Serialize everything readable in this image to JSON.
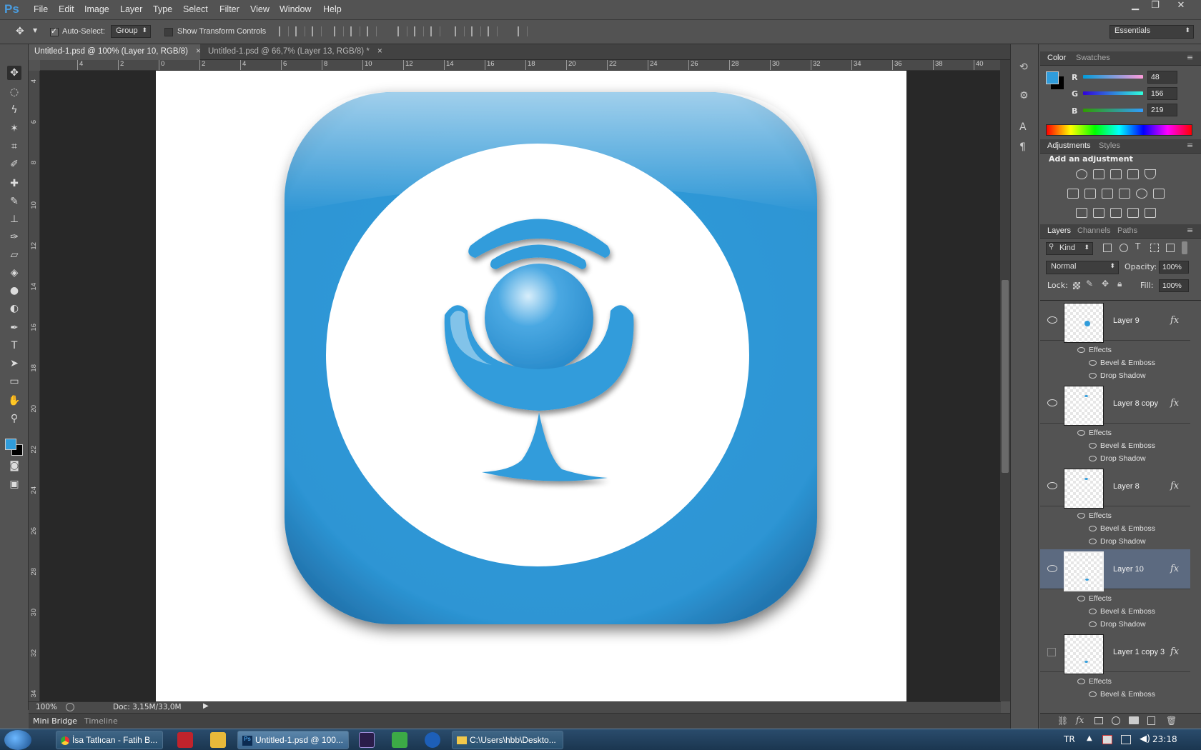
{
  "menubar": {
    "app_logo": "Ps",
    "items": [
      "File",
      "Edit",
      "Image",
      "Layer",
      "Type",
      "Select",
      "Filter",
      "View",
      "Window",
      "Help"
    ]
  },
  "options": {
    "auto_select_label": "Auto-Select:",
    "auto_select_value": "Group",
    "show_transform_label": "Show Transform Controls",
    "workspace": "Essentials"
  },
  "tabs": [
    {
      "label": "Untitled-1.psd @ 100% (Layer 10, RGB/8)",
      "close": "×"
    },
    {
      "label": "Untitled-1.psd @ 66,7% (Layer 13, RGB/8) *",
      "close": "×"
    }
  ],
  "ruler_top": [
    "4",
    "2",
    "0",
    "2",
    "4",
    "6",
    "8",
    "10",
    "12",
    "14",
    "16",
    "18",
    "20",
    "22",
    "24",
    "26",
    "28",
    "30",
    "32",
    "34",
    "36",
    "38",
    "40"
  ],
  "ruler_left": [
    "4",
    "6",
    "8",
    "10",
    "12",
    "14",
    "16",
    "18",
    "20",
    "22",
    "24",
    "26",
    "28",
    "30",
    "32",
    "34"
  ],
  "status": {
    "zoom": "100%",
    "doc": "Doc: 3,15M/33,0M"
  },
  "bottom_tabs": [
    "Mini Bridge",
    "Timeline"
  ],
  "color_panel": {
    "tabs": [
      "Color",
      "Swatches"
    ],
    "channels": [
      {
        "label": "R",
        "value": "48"
      },
      {
        "label": "G",
        "value": "156"
      },
      {
        "label": "B",
        "value": "219"
      }
    ],
    "foreground_color": "#309cdb",
    "background_color": "#000000"
  },
  "adjustments_panel": {
    "tabs": [
      "Adjustments",
      "Styles"
    ],
    "heading": "Add an adjustment"
  },
  "layers_panel": {
    "tabs": [
      "Layers",
      "Channels",
      "Paths"
    ],
    "filter_kind": "Kind",
    "blend_mode": "Normal",
    "opacity_label": "Opacity:",
    "opacity_value": "100%",
    "lock_label": "Lock:",
    "fill_label": "Fill:",
    "fill_value": "100%",
    "layers": [
      {
        "name": "Layer 9",
        "effects_label": "Effects",
        "effects": [
          "Bevel & Emboss",
          "Drop Shadow"
        ],
        "selected": false
      },
      {
        "name": "Layer 8 copy",
        "effects_label": "Effects",
        "effects": [
          "Bevel & Emboss",
          "Drop Shadow"
        ],
        "selected": false
      },
      {
        "name": "Layer 8",
        "effects_label": "Effects",
        "effects": [
          "Bevel & Emboss",
          "Drop Shadow"
        ],
        "selected": false
      },
      {
        "name": "Layer 10",
        "effects_label": "Effects",
        "effects": [
          "Bevel & Emboss",
          "Drop Shadow"
        ],
        "selected": true
      },
      {
        "name": "Layer 1 copy 3",
        "effects_label": "Effects",
        "effects": [
          "Bevel & Emboss"
        ],
        "selected": false
      }
    ]
  },
  "taskbar": {
    "items": [
      {
        "label": "İsa Tatlıcan - Fatih B..."
      },
      {
        "label": "Untitled-1.psd @ 100..."
      },
      {
        "label": "C:\\Users\\hbb\\Deskto..."
      }
    ],
    "language": "TR",
    "clock": "23:18"
  },
  "artwork_colors": {
    "icon_blue": "#309cdb",
    "icon_blue_dark": "#2582c0",
    "circle_white": "#ffffff"
  }
}
